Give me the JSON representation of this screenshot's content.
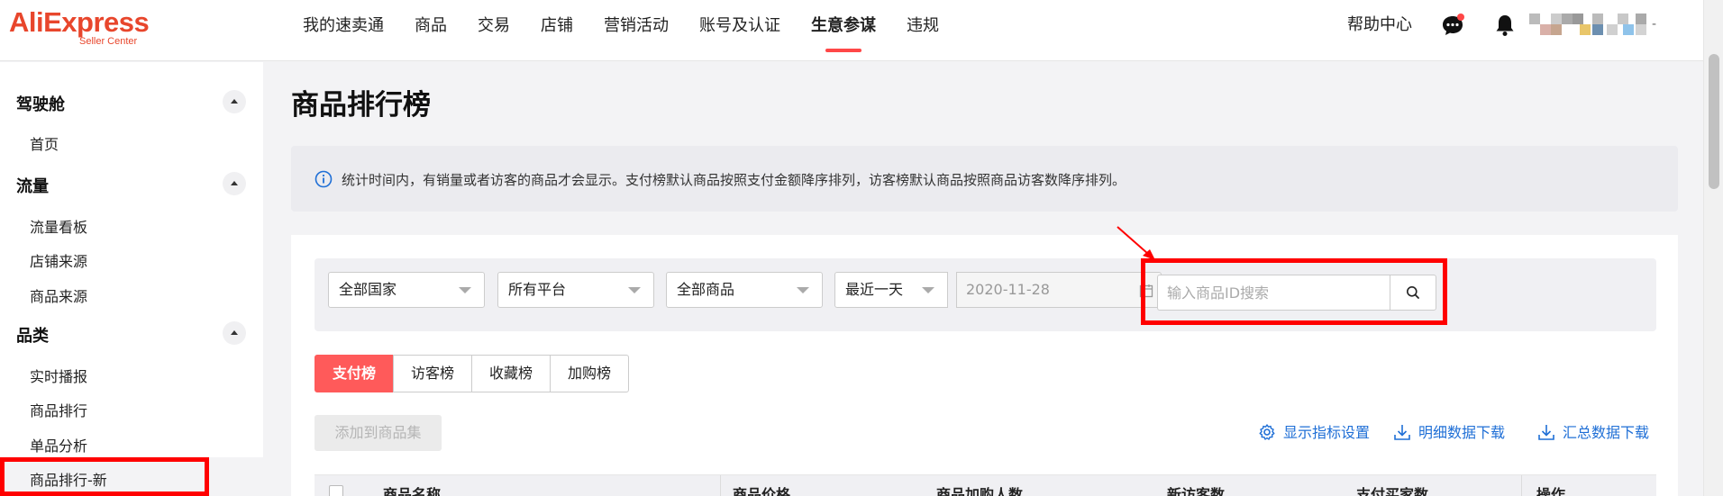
{
  "header": {
    "logo_main": "AliExpress",
    "logo_sub": "Seller Center",
    "nav": [
      "我的速卖通",
      "商品",
      "交易",
      "店铺",
      "营销活动",
      "账号及认证",
      "生意参谋",
      "违规"
    ],
    "active_nav": "生意参谋",
    "help": "帮助中心",
    "dash": "-",
    "icons": {
      "chat": "chat-icon",
      "bell": "bell-icon"
    },
    "accent_color": "#ff4747"
  },
  "sidebar": {
    "groups": [
      {
        "label": "驾驶舱",
        "items": [
          "首页"
        ]
      },
      {
        "label": "流量",
        "items": [
          "流量看板",
          "店铺来源",
          "商品来源"
        ]
      },
      {
        "label": "品类",
        "items": [
          "实时播报",
          "商品排行",
          "单品分析",
          "商品排行-新"
        ]
      }
    ],
    "active_item": "商品排行-新"
  },
  "main": {
    "title": "商品排行榜",
    "notice": "统计时间内，有销量或者访客的商品才会显示。支付榜默认商品按照支付金额降序排列，访客榜默认商品按照商品访客数降序排列。",
    "filters": {
      "country": "全部国家",
      "platform": "所有平台",
      "product": "全部商品",
      "period": "最近一天",
      "date": "2020-11-28",
      "search_placeholder": "输入商品ID搜索"
    },
    "tabs": [
      "支付榜",
      "访客榜",
      "收藏榜",
      "加购榜"
    ],
    "active_tab": "支付榜",
    "add_button": "添加到商品集",
    "actions": [
      "显示指标设置",
      "明细数据下载",
      "汇总数据下载"
    ],
    "table_headers": [
      "商品名称",
      "商品价格",
      "商品加购人数",
      "新访客数",
      "支付买家数",
      "操作"
    ]
  }
}
